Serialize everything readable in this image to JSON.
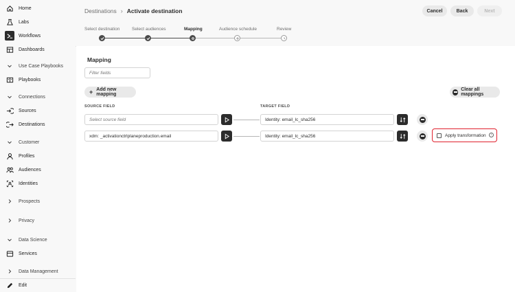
{
  "sidebar": {
    "items": [
      {
        "label": "Home",
        "icon": "home-icon"
      },
      {
        "label": "Labs",
        "icon": "flask-icon"
      },
      {
        "label": "Workflows",
        "icon": "workflow-icon",
        "active": true
      },
      {
        "label": "Dashboards",
        "icon": "dashboard-icon"
      }
    ],
    "sections": {
      "use_case_playbooks": "Use Case Playbooks",
      "playbooks": "Playbooks",
      "connections": "Connections",
      "sources": "Sources",
      "destinations": "Destinations",
      "customer": "Customer",
      "profiles": "Profiles",
      "audiences": "Audiences",
      "identities": "Identities",
      "prospects": "Prospects",
      "privacy": "Privacy",
      "data_science": "Data Science",
      "services": "Services",
      "data_management": "Data Management"
    },
    "edit_label": "Edit"
  },
  "header": {
    "breadcrumb_parent": "Destinations",
    "breadcrumb_separator": "›",
    "breadcrumb_current": "Activate destination",
    "cancel_label": "Cancel",
    "back_label": "Back",
    "next_label": "Next"
  },
  "steps": [
    {
      "label": "Select destination",
      "state": "done"
    },
    {
      "label": "Select audiences",
      "state": "done"
    },
    {
      "label": "Mapping",
      "state": "current"
    },
    {
      "label": "Audience schedule",
      "state": "future"
    },
    {
      "label": "Review",
      "state": "future"
    }
  ],
  "mapping": {
    "title": "Mapping",
    "filter_placeholder": "Filter fields",
    "add_label": "Add new mapping",
    "clear_label": "Clear all mappings",
    "source_header": "SOURCE FIELD",
    "target_header": "TARGET FIELD",
    "rows": [
      {
        "source": "",
        "source_placeholder": "Select source field",
        "target": "Identity: email_lc_sha256"
      },
      {
        "source": "xdm: _activationctrlplaneproduction.email",
        "target": "Identity: email_lc_sha256"
      }
    ],
    "apply_transformation_label": "Apply transformation"
  },
  "colors": {
    "accent_dark": "#2c2c2c",
    "highlight_red": "#e0202c"
  }
}
